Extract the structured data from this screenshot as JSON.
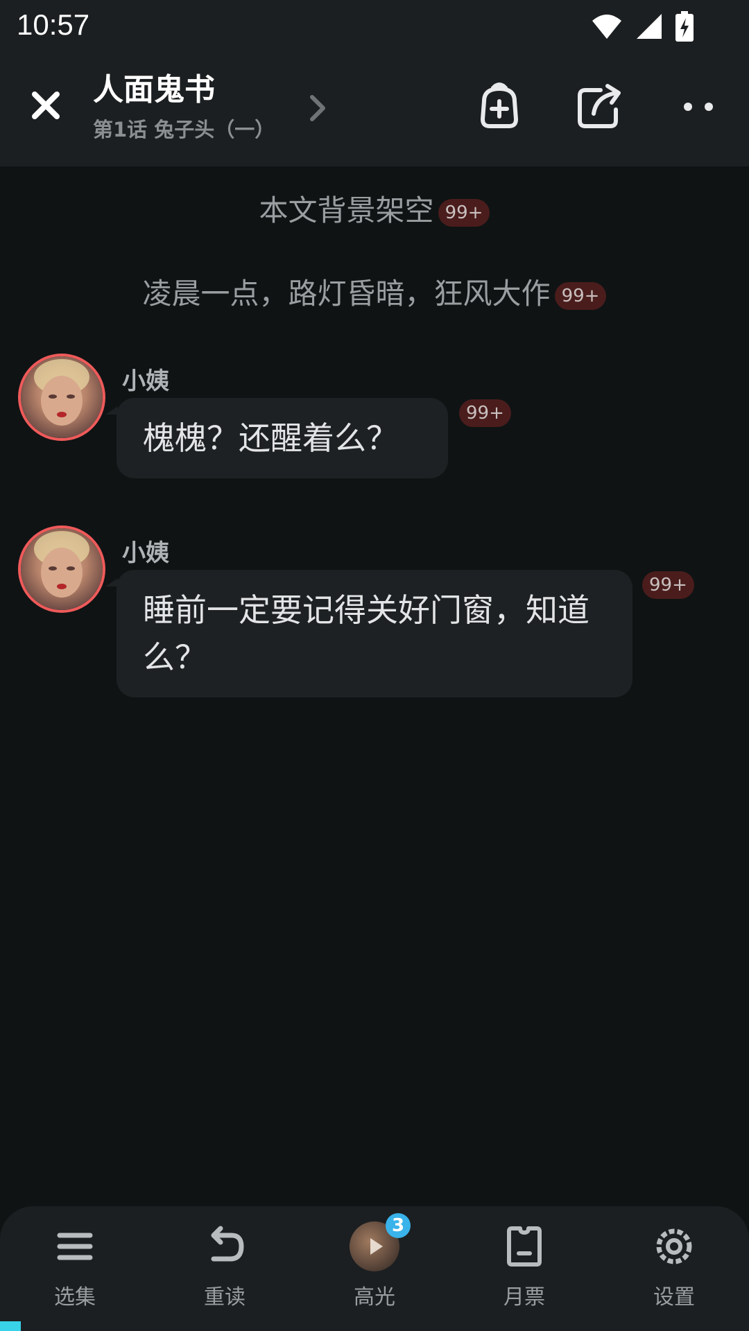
{
  "status_bar": {
    "time": "10:57"
  },
  "header": {
    "title": "人面鬼书",
    "subtitle": "第1话 兔子头（一）"
  },
  "narrations": [
    {
      "text": "本文背景架空",
      "badge": "99+"
    },
    {
      "text": "凌晨一点，路灯昏暗，狂风大作",
      "badge": "99+"
    }
  ],
  "messages": [
    {
      "speaker": "小姨",
      "text": "槐槐？还醒着么？",
      "badge": "99+"
    },
    {
      "speaker": "小姨",
      "text": "睡前一定要记得关好门窗，知道么？",
      "badge": "99+"
    }
  ],
  "bottom_nav": {
    "items": [
      {
        "label": "选集",
        "icon": "menu-icon"
      },
      {
        "label": "重读",
        "icon": "undo-icon"
      },
      {
        "label": "高光",
        "icon": "highlight-thumbnail",
        "count": "3"
      },
      {
        "label": "月票",
        "icon": "ticket-icon"
      },
      {
        "label": "设置",
        "icon": "gear-icon"
      }
    ]
  },
  "colors": {
    "background": "#0f1314",
    "bar": "#1c1f21",
    "bubble": "#1e2123",
    "badge": "#4a1d1c",
    "avatar_ring": "#ef5a5a",
    "accent": "#39b3ea"
  }
}
